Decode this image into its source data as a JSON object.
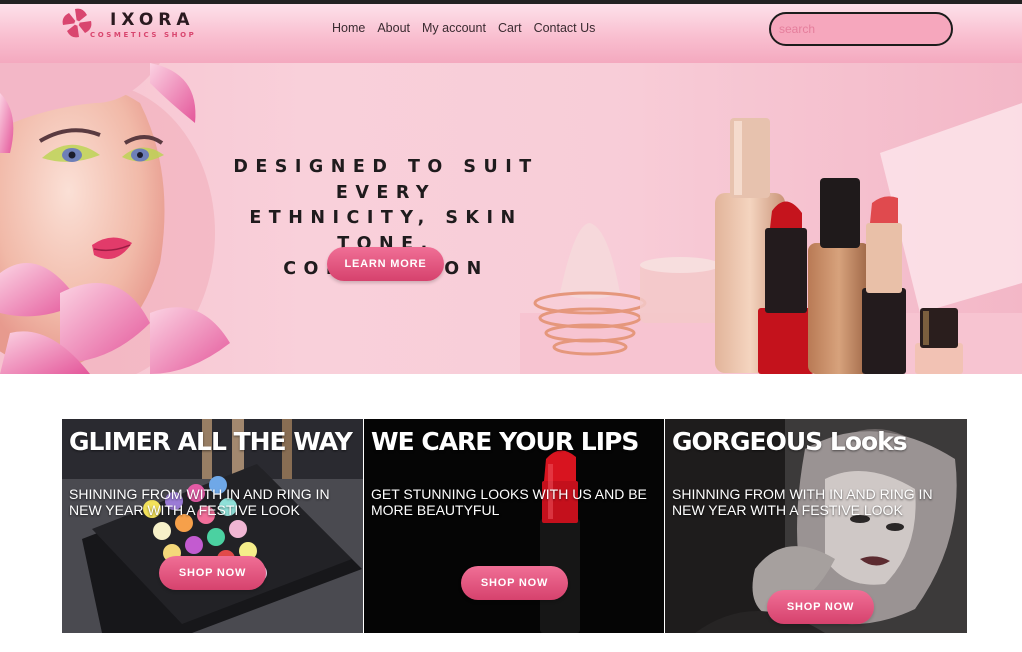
{
  "header": {
    "logo": {
      "name": "IXORA",
      "tagline": "COSMETICS SHOP"
    },
    "nav": [
      "Home",
      "About",
      "My account",
      "Cart",
      "Contact Us"
    ],
    "search": {
      "placeholder": "search",
      "value": ""
    }
  },
  "hero": {
    "title_lines": [
      "DESIGNED TO SUIT EVERY",
      "ETHNICITY, SKIN TONE,",
      "COMPLEXION"
    ],
    "button": "LEARN MORE"
  },
  "cards": [
    {
      "title": "GLIMER ALL THE WAY",
      "text": "SHINNING FROM WITH IN AND RING IN NEW YEAR WITH A FESTIVE LOOK",
      "button": "SHOP NOW"
    },
    {
      "title": "WE CARE YOUR LIPS",
      "text": "GET STUNNING LOOKS WITH US AND BE MORE BEAUTYFUL",
      "button": "SHOP NOW"
    },
    {
      "title": "GORGEOUS Looks",
      "text": "SHINNING FROM WITH IN AND RING IN NEW YEAR WITH A FESTIVE LOOK",
      "button": "SHOP NOW"
    }
  ],
  "colors": {
    "accent": "#e2577f",
    "header_pink": "#f9bfd0",
    "hero_pink": "#f8cdd8",
    "text_dark": "#1f1b1d"
  }
}
